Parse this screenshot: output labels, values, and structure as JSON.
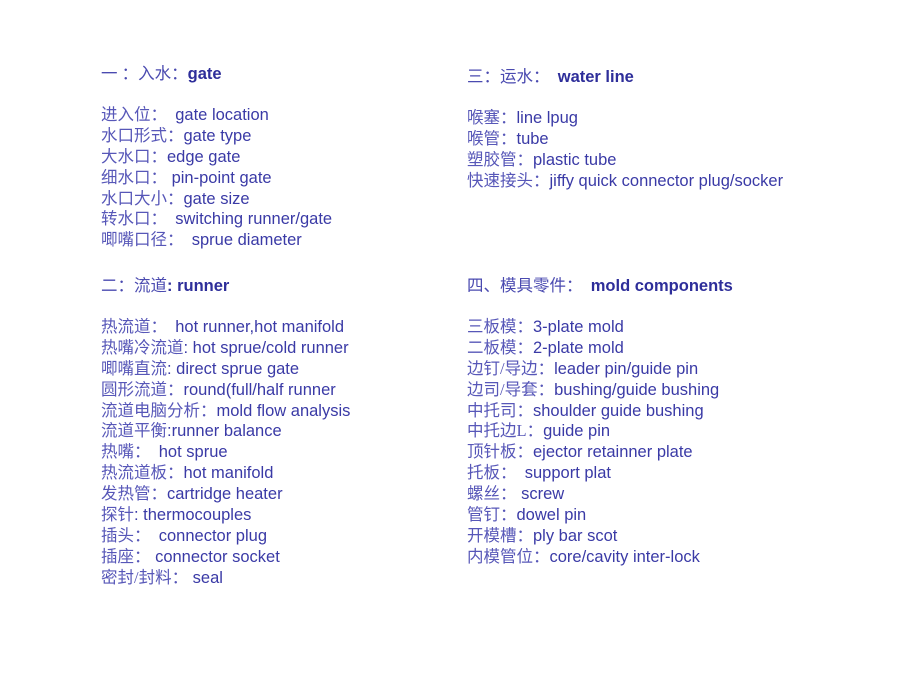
{
  "sections": [
    {
      "heading_zh": "一 ：入水：",
      "heading_en": "gate",
      "items": [
        {
          "zh": "进入位：",
          "en": "　gate location"
        },
        {
          "zh": "水口形式：",
          "en": "gate type"
        },
        {
          "zh": "大水口：",
          "en": "edge gate"
        },
        {
          "zh": "细水口：",
          "en": " pin-point gate"
        },
        {
          "zh": "水口大小：",
          "en": "gate size"
        },
        {
          "zh": "转水口：",
          "en": "　switching runner/gate"
        },
        {
          "zh": "唧嘴口径：",
          "en": "　sprue diameter"
        }
      ]
    },
    {
      "heading_zh": "二：流道",
      "heading_en": ": runner",
      "items": [
        {
          "zh": "热流道：",
          "en": "　hot runner,hot manifold"
        },
        {
          "zh": "热嘴冷流道",
          "en": ": hot sprue/cold runner"
        },
        {
          "zh": "唧嘴直流",
          "en": ": direct sprue gate"
        },
        {
          "zh": "圆形流道：",
          "en": "round(full/half runner"
        },
        {
          "zh": "流道电脑分析：",
          "en": "mold flow analysis"
        },
        {
          "zh": "流道平衡",
          "en": ":runner balance"
        },
        {
          "zh": "热嘴：",
          "en": "　hot sprue"
        },
        {
          "zh": "热流道板：",
          "en": "hot manifold"
        },
        {
          "zh": "发热管：",
          "en": "cartridge heater"
        },
        {
          "zh": "探针",
          "en": ": thermocouples"
        },
        {
          "zh": "插头：",
          "en": "　connector plug"
        },
        {
          "zh": "插座：",
          "en": " connector socket"
        },
        {
          "zh": "密封/封料：",
          "en": " seal"
        }
      ]
    },
    {
      "heading_zh": "三：运水：",
      "heading_en": "　water line",
      "items": [
        {
          "zh": "喉塞：",
          "en": "line lpug"
        },
        {
          "zh": "喉管：",
          "en": "tube"
        },
        {
          "zh": "塑胶管：",
          "en": "plastic tube"
        },
        {
          "zh": "快速接头：",
          "en": "jiffy quick connector plug/socker"
        }
      ]
    },
    {
      "heading_zh": "四、模具零件：",
      "heading_en": "　mold components",
      "items": [
        {
          "zh": "三板模：",
          "en": "3-plate mold"
        },
        {
          "zh": "二板模：",
          "en": "2-plate mold"
        },
        {
          "zh": "边钉/导边：",
          "en": "leader pin/guide pin"
        },
        {
          "zh": "边司/导套：",
          "en": "bushing/guide bushing"
        },
        {
          "zh": "中托司：",
          "en": "shoulder guide bushing"
        },
        {
          "zh": "中托边L：",
          "en": "guide pin"
        },
        {
          "zh": "顶针板：",
          "en": "ejector retainner plate"
        },
        {
          "zh": "托板：",
          "en": "　support plat"
        },
        {
          "zh": "螺丝：",
          "en": " screw"
        },
        {
          "zh": "管钉：",
          "en": "dowel pin"
        },
        {
          "zh": "开模槽：",
          "en": "ply bar scot"
        },
        {
          "zh": "内模管位：",
          "en": "core/cavity inter-lock"
        }
      ]
    }
  ]
}
